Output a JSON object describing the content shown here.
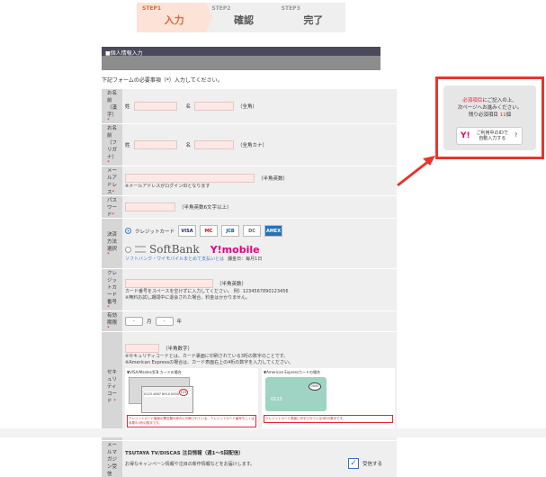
{
  "steps": [
    {
      "num": "STEP1",
      "label": "入力",
      "active": true
    },
    {
      "num": "STEP2",
      "label": "確認",
      "active": false
    },
    {
      "num": "STEP3",
      "label": "完了",
      "active": false
    }
  ],
  "section": {
    "title": "■個人情報入力",
    "notice": "下記フォームの必要事項（*）入力してください。"
  },
  "fields": {
    "name_kanji": {
      "label": "お名前（漢字）",
      "req": "*",
      "sei": "姓",
      "mei": "名",
      "note": "（全角）"
    },
    "name_kana": {
      "label": "お名前（フリガナ）",
      "req": "*",
      "sei": "姓",
      "mei": "名",
      "note": "（全角カナ）"
    },
    "email": {
      "label": "メールアドレス",
      "req": "*",
      "note": "（半角英数）",
      "sub": "※メールアドレスがログインIDとなります"
    },
    "password": {
      "label": "パスワード",
      "req": "*",
      "note": "（半角英数6文字以上）"
    },
    "payment": {
      "label": "決済方法選択",
      "req": "*",
      "credit": "クレジットカード",
      "brands": [
        "VISA",
        "MC",
        "JCB",
        "DC",
        "AMEX"
      ],
      "softbank": "SoftBank",
      "ymobile": "Y!mobile",
      "sb_note": "ソフトバンク・ワイモバイルまとめて支払いとは",
      "sb_fee": "課金日：毎月1日"
    },
    "card_number": {
      "label": "クレジットカード番号",
      "req": "*",
      "note": "（半角英数）",
      "sub1": "カード番号をスペースを空けずに入力してください。 例）1234567890123456",
      "sub2": "※無料お試し期間中に退会された場合、料金はかかりません。"
    },
    "expiry": {
      "label": "有効期限",
      "req": "*",
      "month": "-",
      "year": "-",
      "month_suffix": "月",
      "year_suffix": "年"
    },
    "security": {
      "label": "セキュリティコード",
      "req": "*",
      "note": "（半角数字）",
      "sub1": "※セキュリティコードとは、カード裏面に印刷されている3桁の数字のことです。",
      "sub2": "※American Expressの場合は、カード表面右上の4桁の数字を入力してください。",
      "left_title": "▼VISA/Master/JCB カードの場合",
      "right_title": "▼American Expressカードの場合",
      "left_caption": "クレジットカード裏面の署名欄の枠内に印刷されている、クレジットカード番号もしくは末尾の3桁の数字です。",
      "right_caption": "クレジットカード表面に印字されている3桁の数字です。",
      "card_num": "0123 4567 8910 0000",
      "code": "123",
      "amex_code": "0000",
      "amex_num": "0123"
    },
    "newsletter": {
      "label": "メールマガジン受信",
      "title": "TSUTAYA TV/DISCAS 注目情報（週1～5回配信）",
      "desc": "お得なキャンペーン情報や注目の新作情報などをお届けします。",
      "check_label": "受信する",
      "checked": "✓"
    }
  },
  "popup": {
    "line1_red": "必須項目",
    "line1": "にご記入の上、",
    "line2": "次ページへお進みください。",
    "line3": "残り必須項目",
    "count": "11",
    "unit": "個",
    "ybtn_logo": "Y!",
    "ybtn_l1": "ご利用中のIDで",
    "ybtn_l2": "自動入力する",
    "help": "?"
  }
}
